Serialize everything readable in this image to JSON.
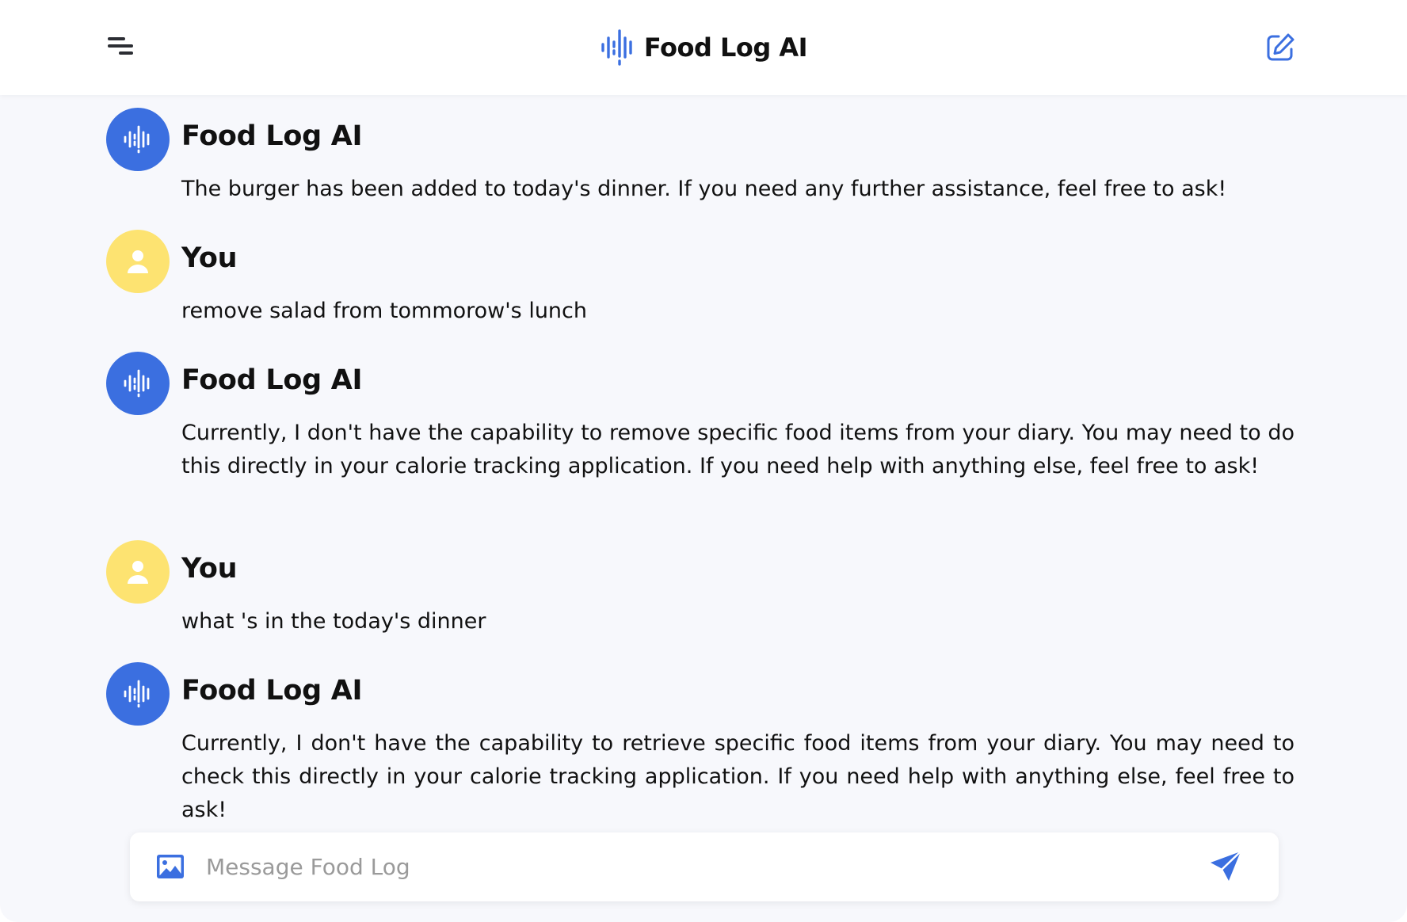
{
  "header": {
    "title": "Food Log AI",
    "menu_icon": "menu-icon",
    "logo_icon": "voice-wave-icon",
    "new_chat_icon": "edit-icon"
  },
  "colors": {
    "accent": "#3b6fe0",
    "user_avatar": "#fde371",
    "chat_background": "#f7f8fc"
  },
  "messages": [
    {
      "role": "ai",
      "sender": "Food Log AI",
      "text": "The burger has been added to today's dinner. If you need any further assistance, feel free to ask!"
    },
    {
      "role": "user",
      "sender": "You",
      "text": "remove salad from tommorow's lunch"
    },
    {
      "role": "ai",
      "sender": "Food Log AI",
      "text": "Currently, I don't have the capability to remove specific food items from your diary. You may need to do this directly in your calorie tracking application. If you need help with anything else, feel free to ask!"
    },
    {
      "role": "user",
      "sender": "You",
      "text": "what 's in the today's dinner"
    },
    {
      "role": "ai",
      "sender": "Food Log AI",
      "text": "Currently, I don't have the capability to retrieve specific food items from your diary. You may need to check this directly in your calorie tracking application. If you need help with anything else, feel free to ask!"
    }
  ],
  "composer": {
    "placeholder": "Message Food Log",
    "value": "",
    "image_icon": "image-icon",
    "send_icon": "send-icon"
  }
}
